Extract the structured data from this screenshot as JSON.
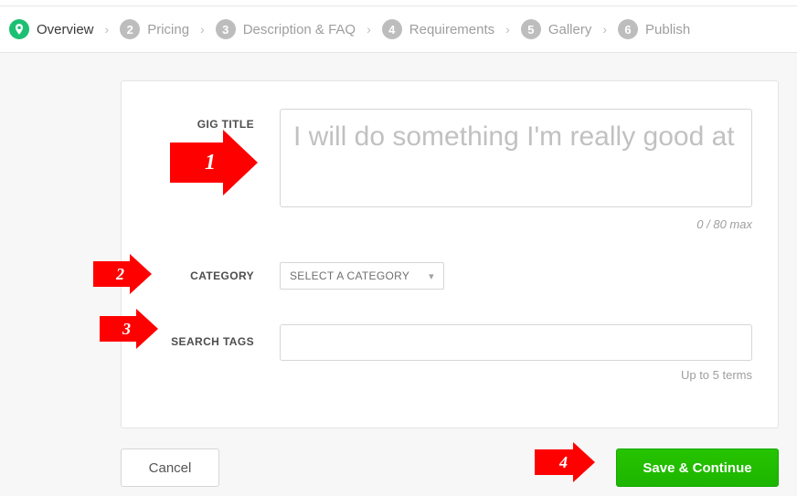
{
  "stepper": {
    "steps": [
      {
        "num": "1",
        "label": "Overview",
        "active": true
      },
      {
        "num": "2",
        "label": "Pricing"
      },
      {
        "num": "3",
        "label": "Description & FAQ"
      },
      {
        "num": "4",
        "label": "Requirements"
      },
      {
        "num": "5",
        "label": "Gallery"
      },
      {
        "num": "6",
        "label": "Publish"
      }
    ]
  },
  "form": {
    "gig_title_label": "GIG TITLE",
    "gig_title_placeholder": "I will do something I'm really good at",
    "gig_title_value": "",
    "gig_title_counter": "0 / 80 max",
    "category_label": "CATEGORY",
    "category_placeholder": "SELECT A CATEGORY",
    "tags_label": "SEARCH TAGS",
    "tags_hint": "Up to 5 terms"
  },
  "actions": {
    "cancel": "Cancel",
    "save": "Save & Continue"
  },
  "annotations": {
    "a1": "1",
    "a2": "2",
    "a3": "3",
    "a4": "4"
  }
}
